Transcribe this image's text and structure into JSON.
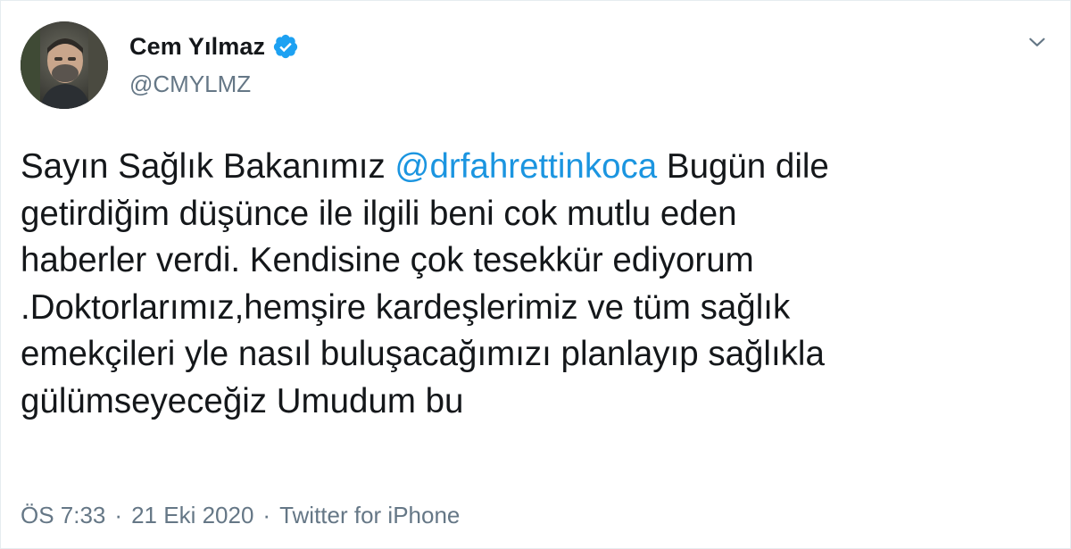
{
  "tweet": {
    "author": {
      "display_name": "Cem Yılmaz",
      "handle": "@CMYLMZ",
      "verified": true,
      "avatar_icon": "user-avatar-photo"
    },
    "text": {
      "before_mention": "Sayın Sağlık Bakanımız ",
      "mention": "@drfahrettinkoca",
      "after_mention": " Bugün dile\ngetirdiğim düşünce ile ilgili beni cok mutlu eden\nhaberler verdi. Kendisine çok tesekkür ediyorum\n.Doktorlarımız,hemşire kardeşlerimiz ve tüm sağlık\nemekçileri yle nasıl buluşacağımızı planlayıp sağlıkla\ngülümseyeceğiz Umudum bu"
    },
    "meta": {
      "time": "ÖS 7:33",
      "separator1": "·",
      "date": "21 Eki 2020",
      "separator2": "·",
      "source": "Twitter for iPhone"
    },
    "menu_icon": "chevron-down-icon",
    "colors": {
      "mention": "#1b95e0",
      "verified": "#1da1f2",
      "secondary_text": "#657786",
      "primary_text": "#14171a"
    }
  }
}
